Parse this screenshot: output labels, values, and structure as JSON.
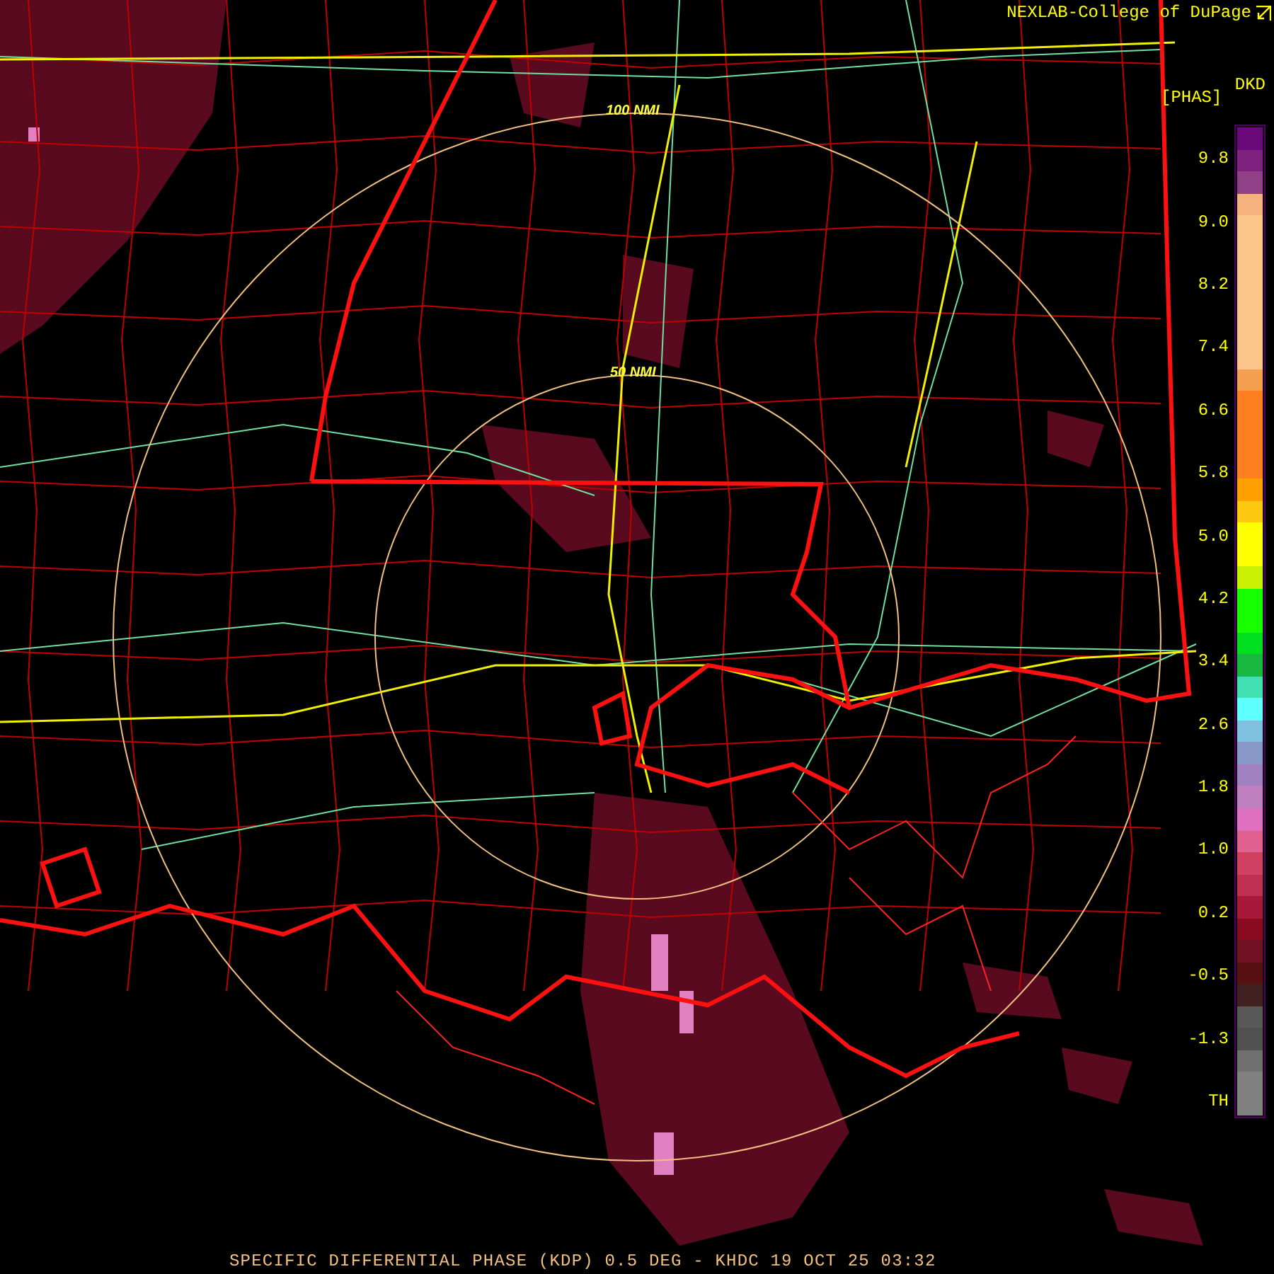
{
  "header": {
    "credit": "NEXLAB-College of DuPage"
  },
  "map": {
    "rings": [
      {
        "label": "100 NMI"
      },
      {
        "label": "50 NMI"
      }
    ]
  },
  "legend": {
    "product": "DKD",
    "unit": "[PHAS]",
    "labels": [
      "9.8",
      "9.0",
      "8.2",
      "7.4",
      "6.6",
      "5.8",
      "5.0",
      "4.2",
      "3.4",
      "2.6",
      "1.8",
      "1.0",
      "0.2",
      "-0.5",
      "-1.3",
      "TH"
    ],
    "swatches": [
      {
        "color": "#6a0a7a"
      },
      {
        "color": "#80207f"
      },
      {
        "color": "#904086"
      },
      {
        "color": "#f5b27e"
      },
      {
        "color": "#fcc68a"
      },
      {
        "color": "#fcc68a"
      },
      {
        "color": "#fcc68a"
      },
      {
        "color": "#fcc68a"
      },
      {
        "color": "#fcc68a"
      },
      {
        "color": "#fcc68a"
      },
      {
        "color": "#fcc68a"
      },
      {
        "color": "#f5a050"
      },
      {
        "color": "#ff8020"
      },
      {
        "color": "#ff8020"
      },
      {
        "color": "#ff8020"
      },
      {
        "color": "#ff8020"
      },
      {
        "color": "#ffa000"
      },
      {
        "color": "#ffc810"
      },
      {
        "color": "#ffff00"
      },
      {
        "color": "#ffff00"
      },
      {
        "color": "#c8f000"
      },
      {
        "color": "#18ff00"
      },
      {
        "color": "#18ff00"
      },
      {
        "color": "#00e020"
      },
      {
        "color": "#18b840"
      },
      {
        "color": "#40e0b0"
      },
      {
        "color": "#60ffff"
      },
      {
        "color": "#80c0e0"
      },
      {
        "color": "#8898c8"
      },
      {
        "color": "#a080c0"
      },
      {
        "color": "#c080c0"
      },
      {
        "color": "#e070c0"
      },
      {
        "color": "#e06090"
      },
      {
        "color": "#d04060"
      },
      {
        "color": "#c03050"
      },
      {
        "color": "#a81838"
      },
      {
        "color": "#8a0a20"
      },
      {
        "color": "#701020"
      },
      {
        "color": "#581010"
      },
      {
        "color": "#402020"
      },
      {
        "color": "#585858"
      },
      {
        "color": "#505050"
      },
      {
        "color": "#707070"
      },
      {
        "color": "#808080"
      },
      {
        "color": "#808080"
      }
    ]
  },
  "footer": {
    "caption": "SPECIFIC DIFFERENTIAL PHASE (KDP) 0.5 DEG - KHDC 19 OCT 25 03:32"
  }
}
